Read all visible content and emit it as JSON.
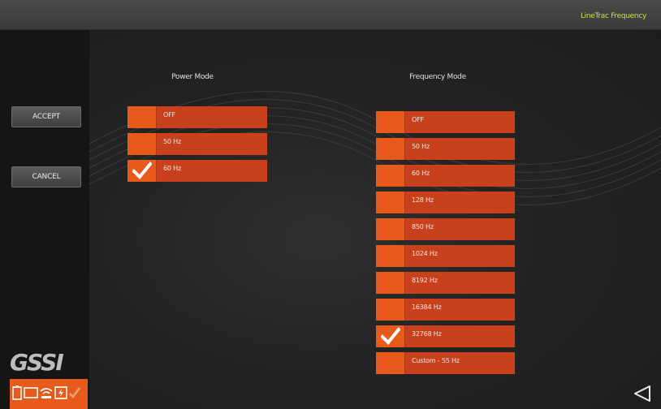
{
  "header": {
    "title": "LineTrac Frequency"
  },
  "sidebar": {
    "accept_label": "ACCEPT",
    "cancel_label": "CANCEL",
    "logo_text": "GSSI",
    "status_icons": [
      "battery-icon",
      "screen-icon",
      "wifi-icon",
      "power-icon",
      "check-icon"
    ]
  },
  "power_mode": {
    "heading": "Power Mode",
    "options": [
      {
        "label": "OFF",
        "checked": false
      },
      {
        "label": "50 Hz",
        "checked": false
      },
      {
        "label": "60 Hz",
        "checked": true
      }
    ]
  },
  "frequency_mode": {
    "heading": "Frequency Mode",
    "options": [
      {
        "label": "OFF",
        "checked": false
      },
      {
        "label": "50 Hz",
        "checked": false
      },
      {
        "label": "60 Hz",
        "checked": false
      },
      {
        "label": "128 Hz",
        "checked": false
      },
      {
        "label": "850 Hz",
        "checked": false
      },
      {
        "label": "1024 Hz",
        "checked": false
      },
      {
        "label": "8192 Hz",
        "checked": false
      },
      {
        "label": "16384 Hz",
        "checked": false
      },
      {
        "label": "32768 Hz",
        "checked": true
      },
      {
        "label": "Custom - 55 Hz",
        "checked": false
      }
    ]
  },
  "colors": {
    "accent": "#e85a1a",
    "option_bg": "#c8401c",
    "title": "#c8e63c"
  },
  "nav": {
    "back_icon": "back-triangle-icon"
  }
}
